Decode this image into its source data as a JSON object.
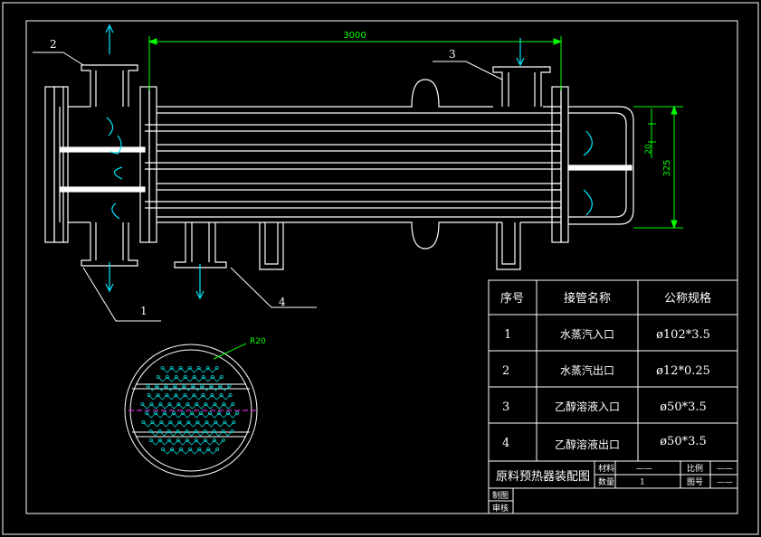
{
  "dimensions": {
    "length": "3000",
    "baffle": "20",
    "height": "325",
    "radius": "R20"
  },
  "callouts": [
    "2",
    "3",
    "1",
    "4"
  ],
  "table": {
    "headers": [
      "序号",
      "接管名称",
      "公称规格"
    ],
    "rows": [
      {
        "no": "1",
        "name": "水蒸汽入口",
        "spec": "ø102*3.5"
      },
      {
        "no": "2",
        "name": "水蒸汽出口",
        "spec": "ø12*0.25"
      },
      {
        "no": "3",
        "name": "乙醇溶液入口",
        "spec": "ø50*3.5"
      },
      {
        "no": "4",
        "name": "乙醇溶液出口",
        "spec": "ø50*3.5"
      }
    ]
  },
  "title_block": {
    "title": "原料预热器装配图",
    "material_label": "材料",
    "material_value": "——",
    "quantity_label": "数量",
    "quantity_value": "1",
    "scale_label": "比例",
    "scale_value": "——",
    "drawing_no_label": "图号",
    "drawing_no_value": "——",
    "drawn_by_label": "制图",
    "checked_by_label": "审核"
  },
  "colors": {
    "background": "#000000",
    "lines": "#ffffff",
    "dimension": "#00ff00",
    "flow_arrow": "#00e5ff",
    "tube_pattern": "#00cccc",
    "centerline": "#ff33ff"
  }
}
